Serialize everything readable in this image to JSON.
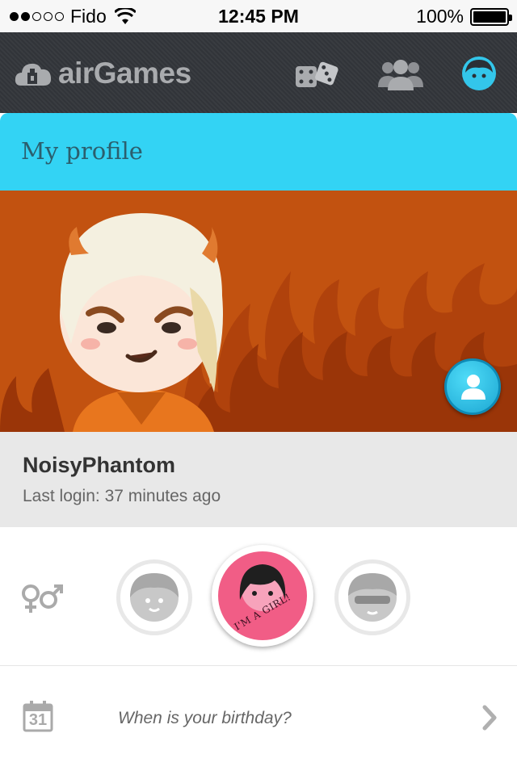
{
  "status_bar": {
    "carrier": "Fido",
    "time": "12:45 PM",
    "battery": "100%",
    "signal_bars_filled": 2,
    "signal_bars_total": 5
  },
  "app_bar": {
    "app_name": "airGames",
    "nav_items": [
      "dice-icon",
      "users-icon",
      "avatar-icon"
    ]
  },
  "profile": {
    "title": "My profile",
    "username": "NoisyPhantom",
    "last_login": "Last login: 37 minutes ago"
  },
  "gender": {
    "options": [
      "boy",
      "girl",
      "cool"
    ],
    "selected": "girl",
    "badge": "I'M A GIRL!"
  },
  "birthday": {
    "calendar_day": "31",
    "prompt": "When is your birthday?"
  },
  "colors": {
    "accent": "#33d3f4",
    "banner": "#c25210",
    "girl_selected": "#f15d86"
  }
}
